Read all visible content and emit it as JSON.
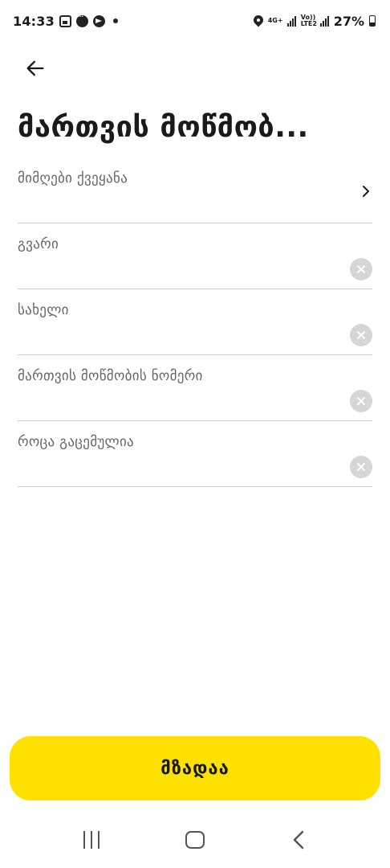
{
  "status_bar": {
    "time": "14:33",
    "network_top": "4G+",
    "network_bottom": "Vo)) LTE2",
    "battery": "27%"
  },
  "header": {
    "back_icon": "arrow-left-icon",
    "title": "მართვის მოწმობ..."
  },
  "form": {
    "fields": [
      {
        "label": "მიმღები ქვეყანა",
        "value": "",
        "control": "chevron-right-icon"
      },
      {
        "label": "გვარი",
        "value": "",
        "control": "clear-icon"
      },
      {
        "label": "სახელი",
        "value": "",
        "control": "clear-icon"
      },
      {
        "label": "მართვის მოწმობის ნომერი",
        "value": "",
        "control": "clear-icon"
      },
      {
        "label": "როცა გაცემულია",
        "value": "",
        "control": "clear-icon"
      }
    ]
  },
  "submit": {
    "label": "მზადაა"
  },
  "colors": {
    "accent": "#ffe100",
    "text": "#1a1a1a",
    "label": "#666666",
    "divider": "#cfcfcf",
    "clear_button": "#d6d6d6"
  },
  "nav_bar": {
    "recent_icon": "recent-apps-icon",
    "home_icon": "home-icon",
    "back_icon": "nav-back-icon"
  }
}
